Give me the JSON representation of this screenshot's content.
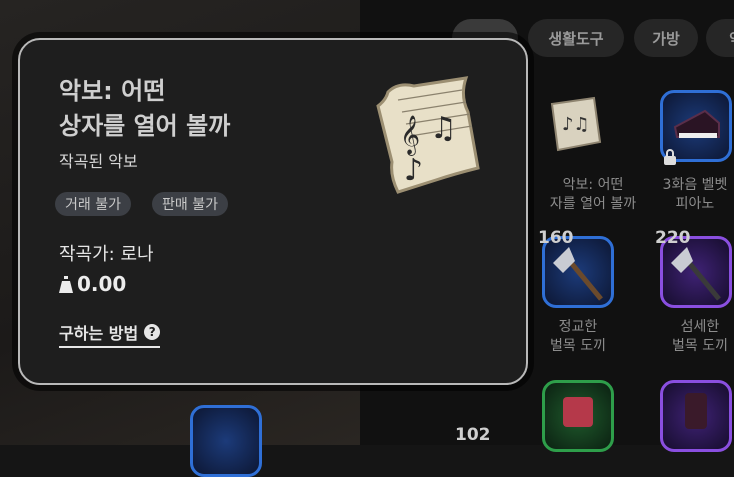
{
  "tabs": [
    {
      "label": ""
    },
    {
      "label": "생활도구"
    },
    {
      "label": "가방"
    },
    {
      "label": "악"
    }
  ],
  "inventory": {
    "items": [
      {
        "name": "악보: 어떤\n자를 열어 볼까",
        "count": ""
      },
      {
        "name": "3화음 벨벳\n피아노",
        "count": "",
        "locked": true
      },
      {
        "name": "정교한\n벌목 도끼",
        "count": "160"
      },
      {
        "name": "섬세한\n벌목 도끼",
        "count": "220"
      },
      {
        "name": "",
        "count": "102"
      }
    ]
  },
  "tooltip": {
    "title_line1": "악보: 어떤",
    "title_line2": "상자를 열어 볼까",
    "subtitle": "작곡된 악보",
    "badges": [
      "거래 불가",
      "판매 불가"
    ],
    "composer": "작곡가: 로나",
    "price": "0.00",
    "how_to_get": "구하는 방법",
    "help_glyph": "?"
  },
  "colors": {
    "card_bg": "#1e1e1e",
    "card_border": "#b9b9b9",
    "badge_bg": "#3c3f45",
    "rarity_blue": "#2f6fd6",
    "rarity_purple": "#8a4fe0",
    "rarity_green": "#2e9e4a"
  },
  "icons": [
    "sheet-music-icon",
    "lock-icon",
    "axe-icon",
    "piano-icon",
    "weight-icon",
    "question-circle-icon"
  ]
}
